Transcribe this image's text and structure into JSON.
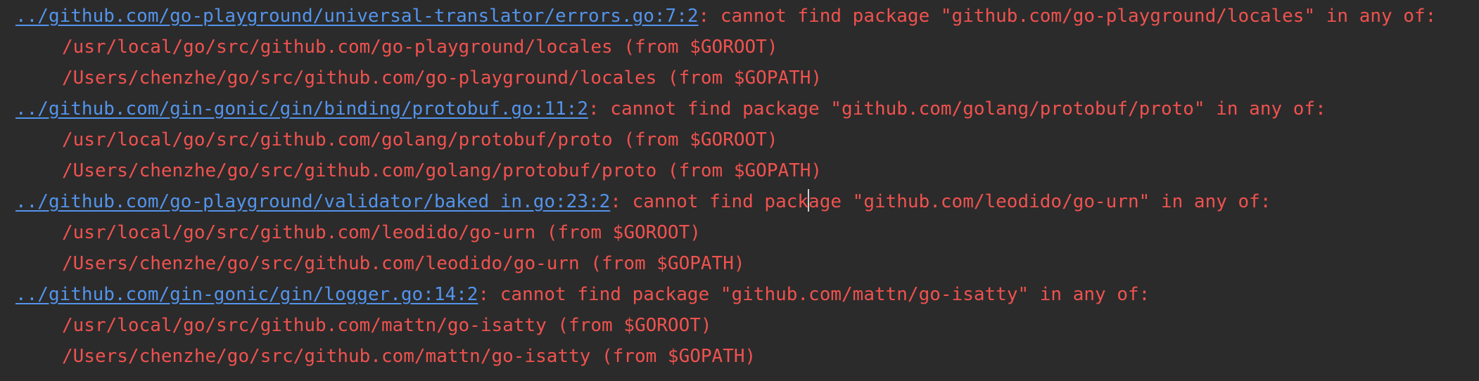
{
  "console": {
    "errors": [
      {
        "link": "../github.com/go-playground/universal-translator/errors.go:7:2",
        "message": ": cannot find package \"github.com/go-playground/locales\" in any of:",
        "paths": [
          "/usr/local/go/src/github.com/go-playground/locales (from $GOROOT)",
          "/Users/chenzhe/go/src/github.com/go-playground/locales (from $GOPATH)"
        ]
      },
      {
        "link": "../github.com/gin-gonic/gin/binding/protobuf.go:11:2",
        "message": ": cannot find package \"github.com/golang/protobuf/proto\" in any of:",
        "paths": [
          "/usr/local/go/src/github.com/golang/protobuf/proto (from $GOROOT)",
          "/Users/chenzhe/go/src/github.com/golang/protobuf/proto (from $GOPATH)"
        ]
      },
      {
        "link": "../github.com/go-playground/validator/baked_in.go:23:2",
        "message_before_caret": ": cannot find pack",
        "message_after_caret": "age \"github.com/leodido/go-urn\" in any of:",
        "paths": [
          "/usr/local/go/src/github.com/leodido/go-urn (from $GOROOT)",
          "/Users/chenzhe/go/src/github.com/leodido/go-urn (from $GOPATH)"
        ]
      },
      {
        "link": "../github.com/gin-gonic/gin/logger.go:14:2",
        "message": ": cannot find package \"github.com/mattn/go-isatty\" in any of:",
        "paths": [
          "/usr/local/go/src/github.com/mattn/go-isatty (from $GOROOT)",
          "/Users/chenzhe/go/src/github.com/mattn/go-isatty (from $GOPATH)"
        ]
      }
    ]
  },
  "colors": {
    "background": "#2b2b2b",
    "error_text": "#f0524f",
    "link": "#5394ec",
    "caret": "#cfcfcf"
  }
}
